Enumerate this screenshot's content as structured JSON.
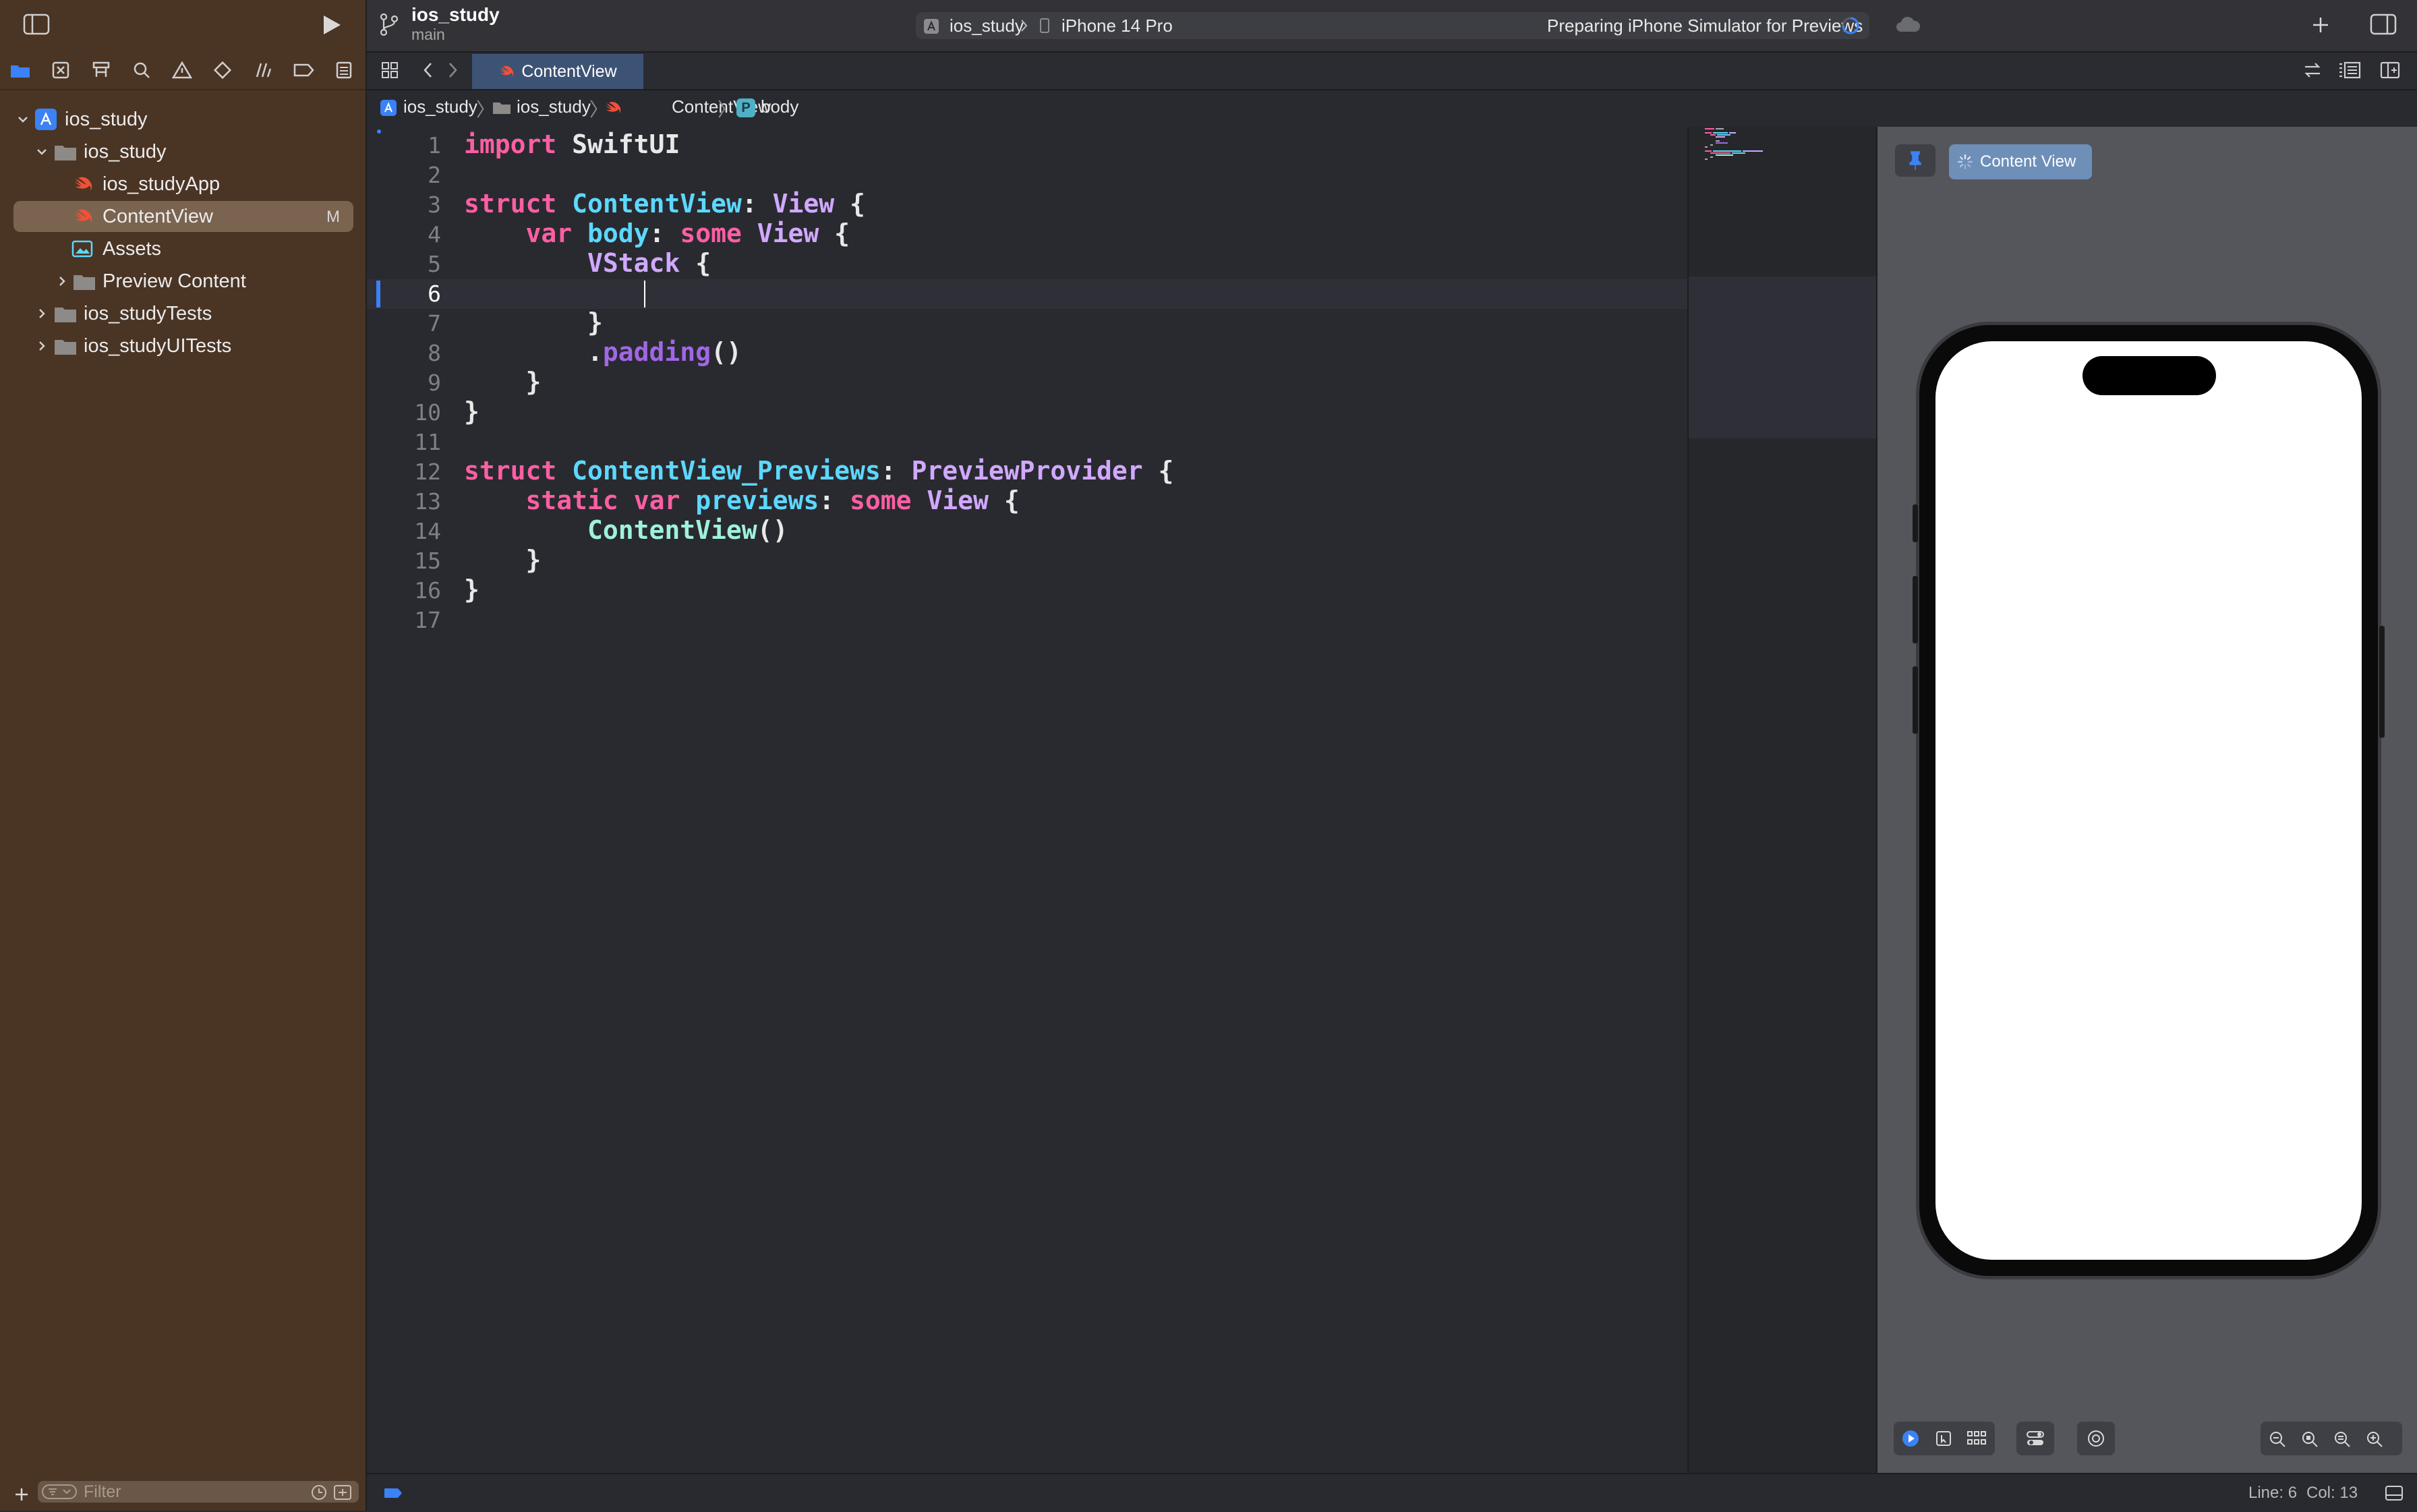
{
  "toolbar": {
    "project_name": "ios_study",
    "branch": "main",
    "scheme_name": "ios_study",
    "device_name": "iPhone 14 Pro",
    "status_text": "Preparing iPhone Simulator for Previews"
  },
  "tab": {
    "label": "ContentView"
  },
  "jumpbar": {
    "items": [
      "ios_study",
      "ios_study",
      "ContentView",
      "body"
    ],
    "symbol_badge": "P"
  },
  "navigator": {
    "tree": [
      {
        "label": "ios_study"
      },
      {
        "label": "ios_study"
      },
      {
        "label": "ios_studyApp"
      },
      {
        "label": "ContentView",
        "badge": "M"
      },
      {
        "label": "Assets"
      },
      {
        "label": "Preview Content"
      },
      {
        "label": "ios_studyTests"
      },
      {
        "label": "ios_studyUITests"
      }
    ],
    "filter_placeholder": "Filter"
  },
  "editor": {
    "line_numbers": [
      "1",
      "2",
      "3",
      "4",
      "5",
      "6",
      "7",
      "8",
      "9",
      "10",
      "11",
      "12",
      "13",
      "14",
      "15",
      "16",
      "17"
    ],
    "tokens": {
      "import": "import",
      "swiftui": "SwiftUI",
      "struct": "struct",
      "contentview": "ContentView",
      "colon_view": ": ",
      "view": "View",
      "brace": " {",
      "var": "var",
      "body": "body",
      "some": "some",
      "vstack": "VStack",
      "close": "}",
      "dot": ".",
      "padding": "padding",
      "parens": "()",
      "previews_struct": "ContentView_Previews",
      "preview_provider": "PreviewProvider",
      "static": "static",
      "previews": "previews",
      "colon": ":"
    }
  },
  "canvas": {
    "preview_label": "Content View"
  },
  "status": {
    "line": "Line: 6",
    "col": "Col: 13"
  },
  "colors": {
    "navigator_bg": "#4a3424",
    "accent": "#3a82f6",
    "keyword": "#fc5fa3",
    "type": "#5dd8ff",
    "project_type": "#d0a8ff",
    "function": "#a167e6"
  }
}
